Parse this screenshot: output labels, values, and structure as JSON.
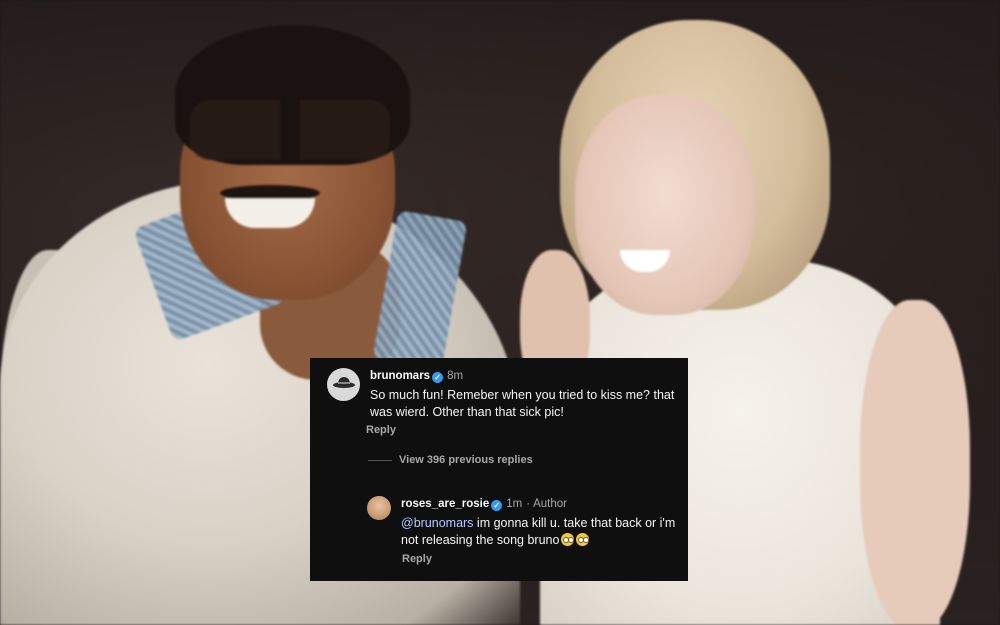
{
  "comments": {
    "main": {
      "username": "brunomars",
      "time": "8m",
      "text": "So much fun! Remeber when you tried to kiss me? that was wierd. Other than that sick pic!",
      "reply_label": "Reply"
    },
    "view_replies_label": "View 396 previous replies",
    "reply": {
      "username": "roses_are_rosie",
      "time": "1m",
      "author_label": "Author",
      "mention": "@brunomars",
      "text": "im gonna kill u. take that back or i'm not releasing the song bruno",
      "reply_label": "Reply"
    }
  }
}
